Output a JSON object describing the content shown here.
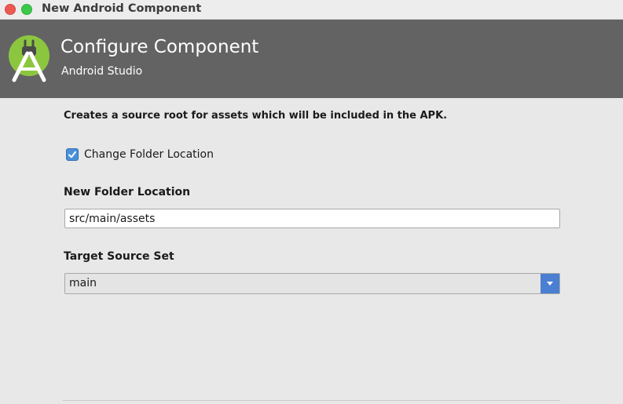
{
  "window": {
    "title": "New Android Component",
    "controls": [
      "close-icon",
      "maximize-icon"
    ]
  },
  "header": {
    "logo_icon": "android-studio-logo-icon",
    "title": "Configure Component",
    "subtitle": "Android Studio"
  },
  "form": {
    "description": "Creates a source root for assets which will be included in the APK.",
    "change_folder": {
      "label": "Change Folder Location",
      "checked": true
    },
    "folder_location": {
      "label": "New Folder Location",
      "value": "src/main/assets"
    },
    "target_source_set": {
      "label": "Target Source Set",
      "selected": "main",
      "icon": "chevron-down-icon"
    }
  },
  "colors": {
    "header_bg": "#636363",
    "accent": "#4a90d9",
    "logo_green": "#8cc63f"
  }
}
